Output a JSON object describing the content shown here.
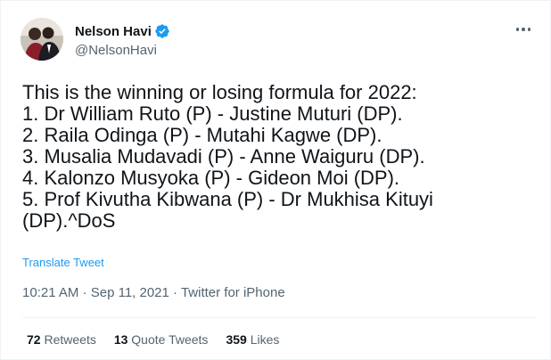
{
  "author": {
    "display_name": "Nelson Havi",
    "handle": "@NelsonHavi",
    "verified": true
  },
  "tweet": {
    "lines": [
      "This is the winning or losing formula for 2022:",
      "1. Dr William Ruto (P) - Justine Muturi (DP).",
      "2. Raila Odinga (P) - Mutahi Kagwe (DP).",
      "3. Musalia Mudavadi (P) - Anne Waiguru (DP).",
      "4. Kalonzo Musyoka (P) - Gideon Moi (DP).",
      "5. Prof Kivutha Kibwana (P)  - Dr Mukhisa Kituyi",
      "(DP).^DoS"
    ],
    "translate_label": "Translate Tweet",
    "time": "10:21 AM",
    "separator": "·",
    "date": "Sep 11, 2021",
    "source": "Twitter for iPhone"
  },
  "stats": {
    "retweets_count": "72",
    "retweets_label": "Retweets",
    "quotes_count": "13",
    "quotes_label": "Quote Tweets",
    "likes_count": "359",
    "likes_label": "Likes"
  },
  "icons": {
    "verified": "verified-badge-icon",
    "more": "more-horizontal-icon"
  },
  "colors": {
    "accent": "#1d9bf0",
    "text_primary": "#0f1419",
    "text_secondary": "#536471",
    "divider": "#eff3f4"
  }
}
